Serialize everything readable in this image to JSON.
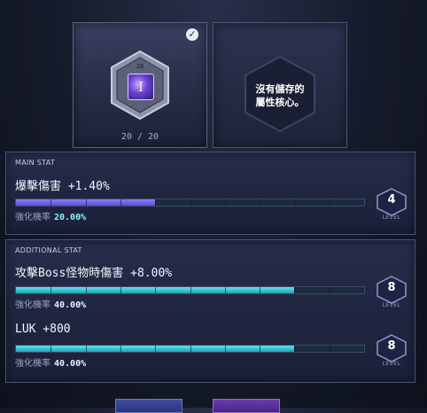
{
  "selected_core": {
    "level": "20",
    "icon_glyph": "I",
    "count": "20 / 20",
    "checked": true
  },
  "empty_slot": {
    "text": "沒有儲存的\n屬性核心。"
  },
  "main_stat": {
    "label": "MAIN STAT",
    "name": "爆擊傷害 +1.40%",
    "progress": 0.4,
    "prob_label": "強化機率",
    "prob_value": "20.00%",
    "level": "4",
    "level_label": "LEVEL"
  },
  "additional_stat": {
    "label": "ADDITIONAL STAT",
    "items": [
      {
        "name": "攻擊Boss怪物時傷害 +8.00%",
        "progress": 0.8,
        "prob_label": "強化機率",
        "prob_value": "40.00%",
        "level": "8",
        "level_label": "LEVEL"
      },
      {
        "name": "LUK +800",
        "progress": 0.8,
        "prob_label": "強化機率",
        "prob_value": "40.00%",
        "level": "8",
        "level_label": "LEVEL"
      }
    ]
  },
  "colors": {
    "main_bar": "#6b5ff0",
    "additional_bar": "#35c3d6",
    "accent_button_left": "#3d4ea0",
    "accent_button_right": "#6a3db2"
  }
}
